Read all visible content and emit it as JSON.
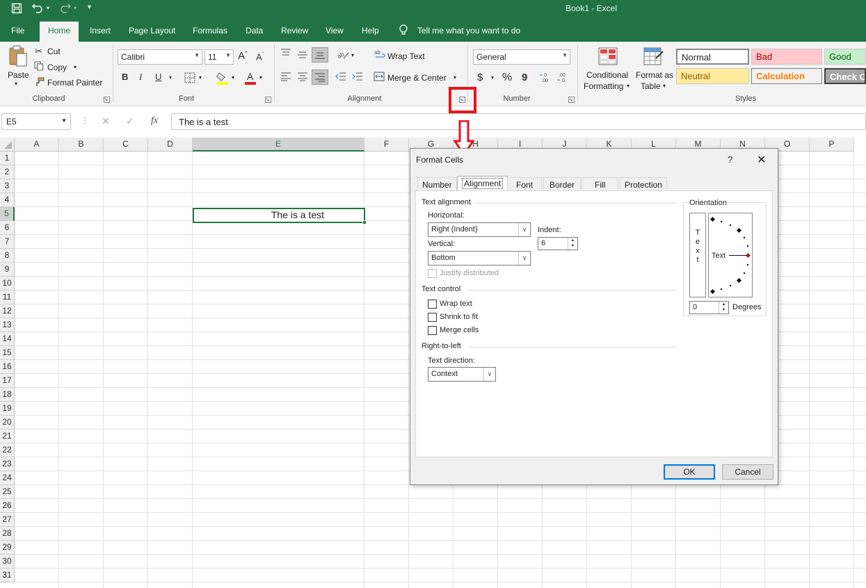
{
  "titlebar": {
    "title": "Book1  -  Excel",
    "save_icon": "save-icon",
    "undo_icon": "undo-icon",
    "redo_icon": "redo-icon"
  },
  "menu": {
    "tabs": [
      "File",
      "Home",
      "Insert",
      "Page Layout",
      "Formulas",
      "Data",
      "Review",
      "View",
      "Help"
    ],
    "active": "Home",
    "tell_me": "Tell me what you want to do"
  },
  "clipboard": {
    "paste": "Paste",
    "cut": "Cut",
    "copy": "Copy",
    "format_painter": "Format Painter",
    "label": "Clipboard"
  },
  "font": {
    "name": "Calibri",
    "size": "11",
    "label": "Font",
    "grow": "A",
    "shrink": "A",
    "bold": "B",
    "italic": "I",
    "underline": "U"
  },
  "alignment": {
    "wrap_text": "Wrap Text",
    "merge_center": "Merge & Center",
    "label": "Alignment"
  },
  "number": {
    "format": "General",
    "label": "Number",
    "currency": "$",
    "percent": "%",
    "comma": "9"
  },
  "styles": {
    "conditional": "Conditional",
    "formatting": "Formatting",
    "format_as": "Format as",
    "table": "Table",
    "label": "Styles",
    "normal": "Normal",
    "bad": "Bad",
    "good": "Good",
    "neutral": "Neutral",
    "calculation": "Calculation",
    "check_cell": "Check Cell"
  },
  "formula_bar": {
    "name_box": "E5",
    "content": "The is a test",
    "cancel": "✕",
    "enter": "✓",
    "fx": "fx"
  },
  "sheet": {
    "columns": [
      "A",
      "B",
      "C",
      "D",
      "E",
      "F",
      "G",
      "H",
      "I",
      "J",
      "K",
      "L",
      "M",
      "N",
      "O",
      "P"
    ],
    "rows": [
      "1",
      "2",
      "3",
      "4",
      "5",
      "6",
      "7",
      "8",
      "9",
      "10",
      "11",
      "12",
      "13",
      "14",
      "15",
      "16",
      "17",
      "18",
      "19",
      "20",
      "21",
      "22",
      "23",
      "24",
      "25",
      "26",
      "27",
      "28",
      "29",
      "30",
      "31"
    ],
    "selected_col": "E",
    "selected_row": "5",
    "cell_e5": "The is a test"
  },
  "dialog": {
    "title": "Format Cells",
    "help": "?",
    "close": "✕",
    "tabs": [
      "Number",
      "Alignment",
      "Font",
      "Border",
      "Fill",
      "Protection"
    ],
    "active_tab": "Alignment",
    "text_alignment": "Text alignment",
    "horizontal_label": "Horizontal:",
    "horizontal_value": "Right (Indent)",
    "indent_label": "Indent:",
    "indent_value": "6",
    "vertical_label": "Vertical:",
    "vertical_value": "Bottom",
    "justify_distributed": "Justify distributed",
    "text_control": "Text control",
    "wrap_text": "Wrap text",
    "shrink_to_fit": "Shrink to fit",
    "merge_cells": "Merge cells",
    "rtl": "Right-to-left",
    "text_direction_label": "Text direction:",
    "text_direction_value": "Context",
    "orientation": "Orientation",
    "vertical_text": [
      "T",
      "e",
      "x",
      "t"
    ],
    "orient_text": "Text",
    "degrees_value": "0",
    "degrees_label": "Degrees",
    "ok": "OK",
    "cancel": "Cancel"
  },
  "annotation": {
    "highlight_color": "#e8141c"
  }
}
